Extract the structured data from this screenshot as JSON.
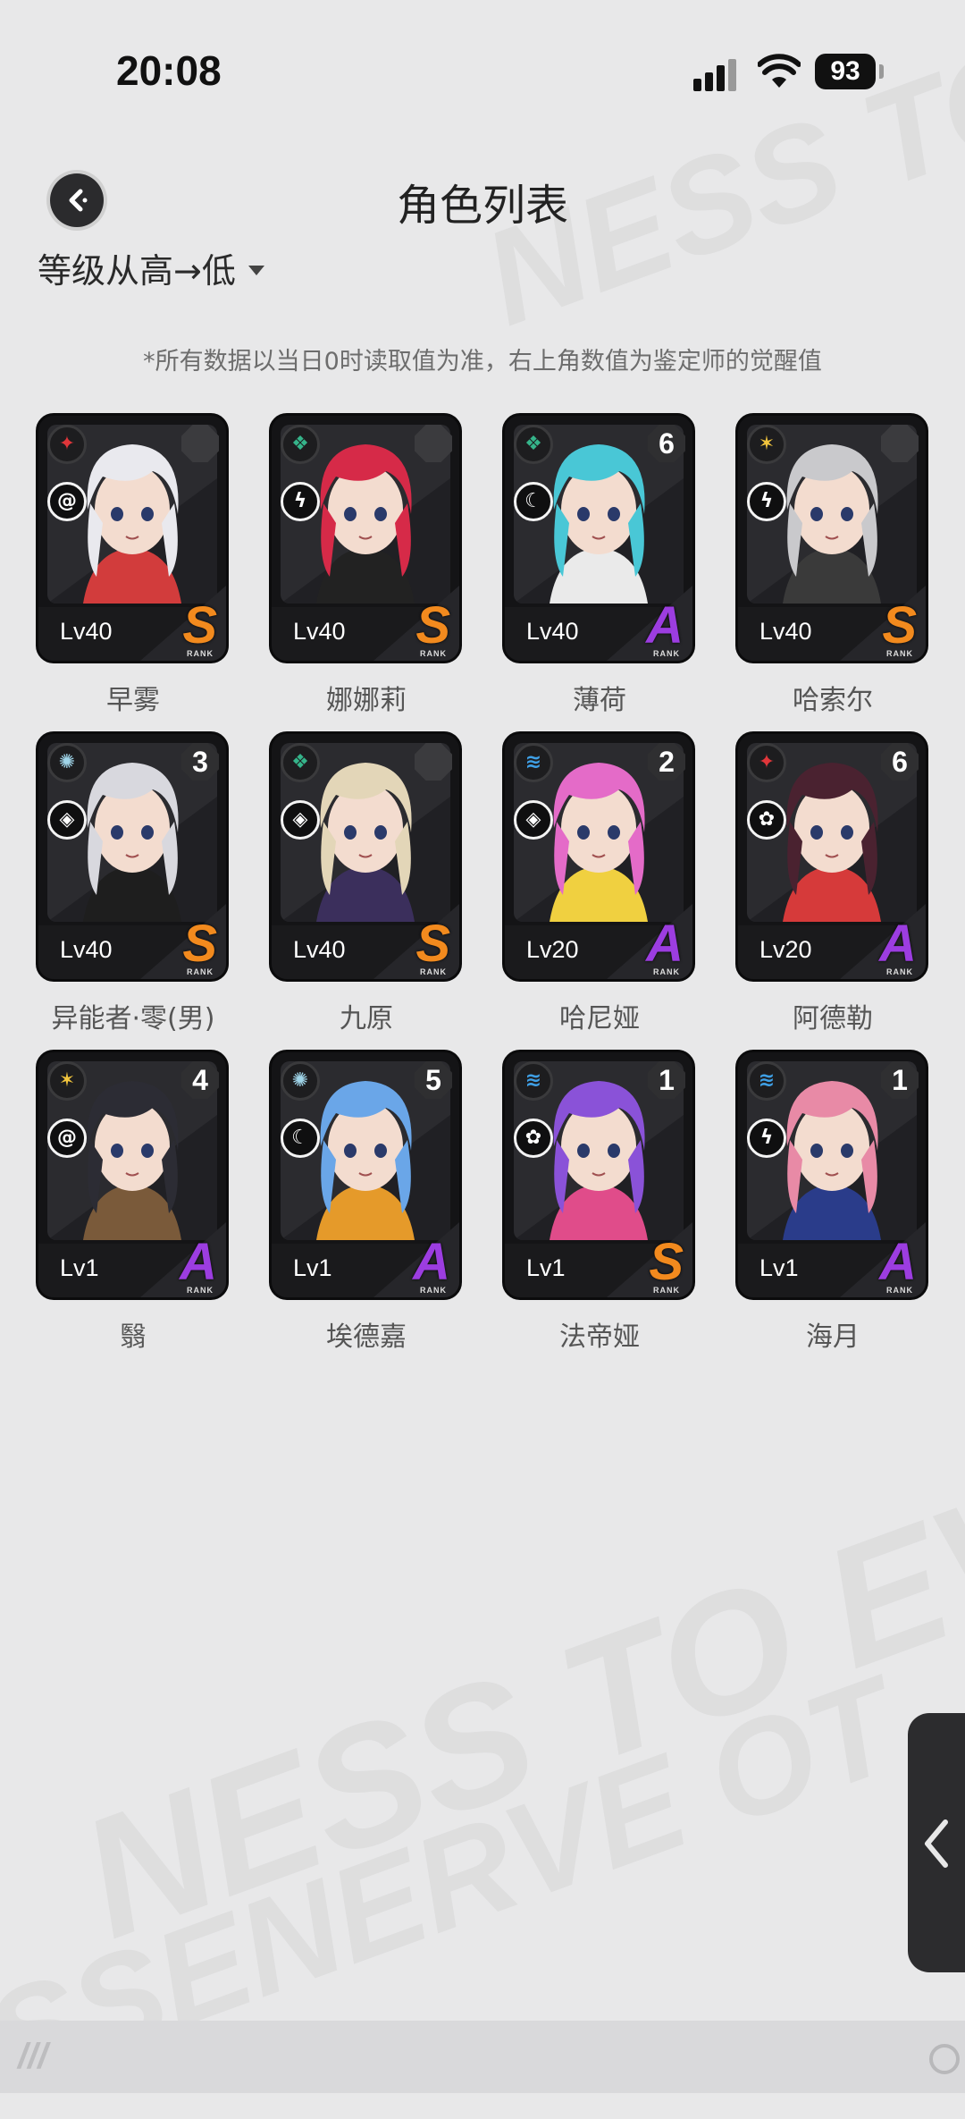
{
  "status": {
    "time": "20:08",
    "battery": "93"
  },
  "header": {
    "title": "角色列表",
    "back_icon": "back-arrow-icon"
  },
  "sort": {
    "label": "等级从高→低"
  },
  "notice": "*所有数据以当日0时读取值为准，右上角数值为鉴定师的觉醒值",
  "rank_sub": "RANK",
  "colors": {
    "rank_S": "#f28a1e",
    "rank_A": "#9c3de0",
    "attr_fire": "#e0363a",
    "attr_water": "#3fa0e6",
    "attr_wind": "#35b48a",
    "attr_light": "#f2c53d",
    "attr_ice": "#9fd4e8"
  },
  "characters": [
    {
      "name": "早雾",
      "level": "Lv40",
      "rank": "S",
      "awakening": "",
      "attribute": "fire",
      "class_icon": "spiral-icon",
      "hair": "#e9e9ee",
      "accent": "#d23c3c"
    },
    {
      "name": "娜娜莉",
      "level": "Lv40",
      "rank": "S",
      "awakening": "",
      "attribute": "wind",
      "class_icon": "bolt-icon",
      "hair": "#d62a48",
      "accent": "#222222"
    },
    {
      "name": "薄荷",
      "level": "Lv40",
      "rank": "A",
      "awakening": "6",
      "attribute": "wind",
      "class_icon": "moon-icon",
      "hair": "#49c7d6",
      "accent": "#eaeaea"
    },
    {
      "name": "哈索尔",
      "level": "Lv40",
      "rank": "S",
      "awakening": "",
      "attribute": "light",
      "class_icon": "bolt-icon",
      "hair": "#c9c9cc",
      "accent": "#3a3a3a"
    },
    {
      "name": "异能者·零(男)",
      "level": "Lv40",
      "rank": "S",
      "awakening": "3",
      "attribute": "ice",
      "class_icon": "cube-icon",
      "hair": "#d8d8de",
      "accent": "#1e1e1e"
    },
    {
      "name": "九原",
      "level": "Lv40",
      "rank": "S",
      "awakening": "",
      "attribute": "wind",
      "class_icon": "cube-icon",
      "hair": "#e3d6b8",
      "accent": "#3b2f5c"
    },
    {
      "name": "哈尼娅",
      "level": "Lv20",
      "rank": "A",
      "awakening": "2",
      "attribute": "water",
      "class_icon": "cube-icon",
      "hair": "#e46bc8",
      "accent": "#f0d040"
    },
    {
      "name": "阿德勒",
      "level": "Lv20",
      "rank": "A",
      "awakening": "6",
      "attribute": "fire",
      "class_icon": "atom-icon",
      "hair": "#4a2230",
      "accent": "#d63a3a"
    },
    {
      "name": "翳",
      "level": "Lv1",
      "rank": "A",
      "awakening": "4",
      "attribute": "light",
      "class_icon": "spiral-icon",
      "hair": "#2c2c34",
      "accent": "#7a5a3a"
    },
    {
      "name": "埃德嘉",
      "level": "Lv1",
      "rank": "A",
      "awakening": "5",
      "attribute": "ice",
      "class_icon": "moon-icon",
      "hair": "#6aa6e8",
      "accent": "#e59a2a"
    },
    {
      "name": "法帝娅",
      "level": "Lv1",
      "rank": "S",
      "awakening": "1",
      "attribute": "water",
      "class_icon": "atom-icon",
      "hair": "#8a52d8",
      "accent": "#e04c8a"
    },
    {
      "name": "海月",
      "level": "Lv1",
      "rank": "A",
      "awakening": "1",
      "attribute": "water",
      "class_icon": "bolt-icon",
      "hair": "#e88aa6",
      "accent": "#2a3c8a"
    }
  ]
}
